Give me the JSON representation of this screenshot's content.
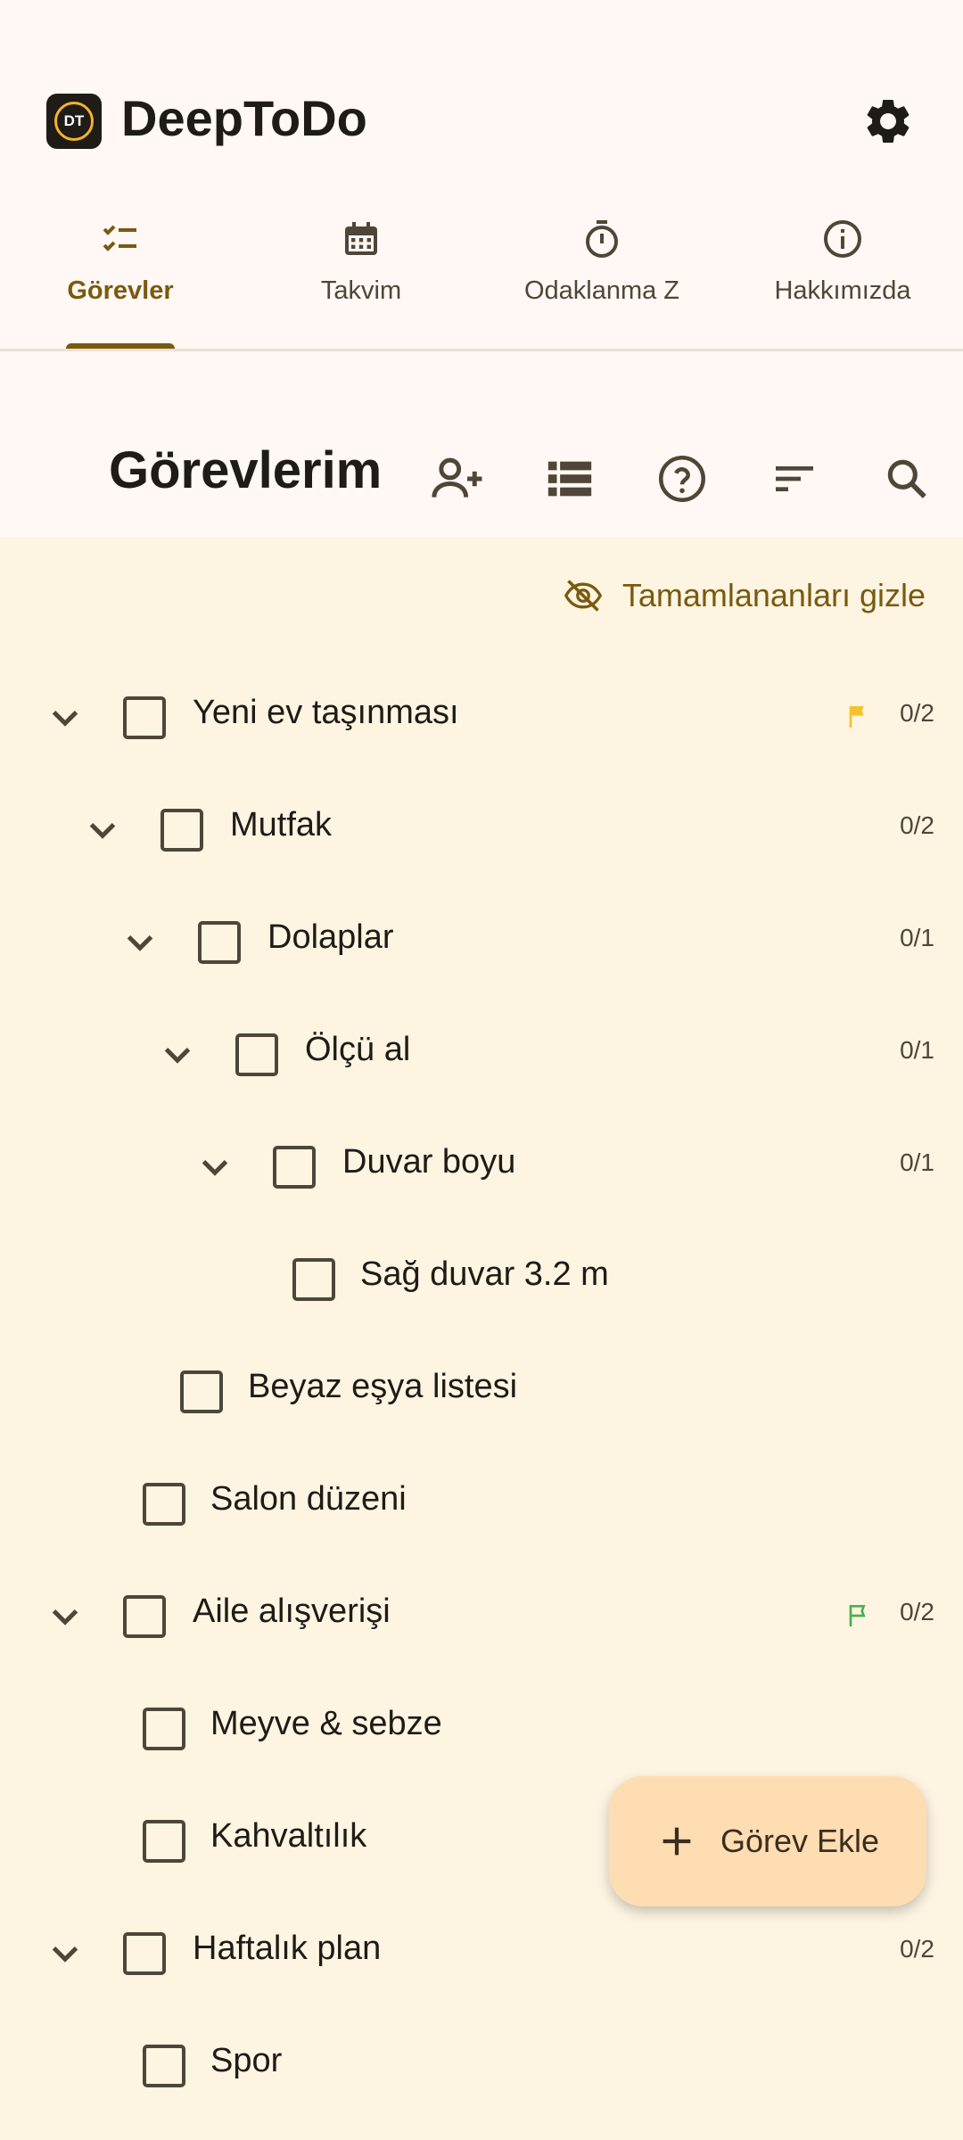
{
  "app": {
    "title": "DeepToDo",
    "logo_text": "DT"
  },
  "tabs": [
    {
      "label": "Görevler",
      "icon": "checklist-icon",
      "active": true
    },
    {
      "label": "Takvim",
      "icon": "calendar-icon",
      "active": false
    },
    {
      "label": "Odaklanma Z",
      "icon": "timer-icon",
      "active": false
    },
    {
      "label": "Hakkımızda",
      "icon": "info-icon",
      "active": false
    }
  ],
  "header": {
    "title": "Görevlerim"
  },
  "filter": {
    "hide_completed_label": "Tamamlananları gizle"
  },
  "tasks": [
    {
      "label": "Yeni ev taşınması",
      "count": "0/2",
      "flag": "yellow"
    },
    {
      "label": "Mutfak",
      "count": "0/2"
    },
    {
      "label": "Dolaplar",
      "count": "0/1"
    },
    {
      "label": "Ölçü al",
      "count": "0/1"
    },
    {
      "label": "Duvar boyu",
      "count": "0/1"
    },
    {
      "label": "Sağ duvar 3.2 m"
    },
    {
      "label": "Beyaz eşya listesi"
    },
    {
      "label": "Salon düzeni"
    },
    {
      "label": "Aile alışverişi",
      "count": "0/2",
      "flag": "green-outline"
    },
    {
      "label": "Meyve & sebze"
    },
    {
      "label": "Kahvaltılık"
    },
    {
      "label": "Haftalık plan",
      "count": "0/2"
    },
    {
      "label": "Spor"
    }
  ],
  "fab": {
    "label": "Görev Ekle"
  },
  "colors": {
    "accent": "#7A5A0F",
    "content_bg": "#FDF5E2",
    "fab_bg": "#FFDDB3",
    "flag_yellow": "#F6C22B",
    "flag_green": "#4CAF50"
  }
}
